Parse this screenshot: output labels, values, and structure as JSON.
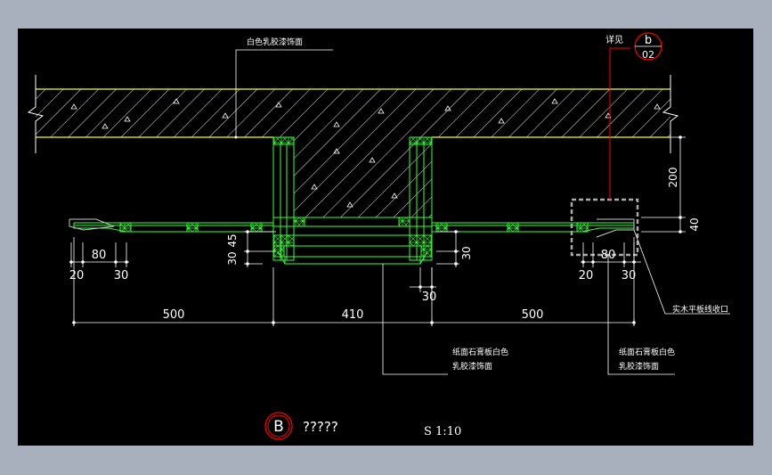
{
  "colors": {
    "background": "#000000",
    "outer": "#a9b0bd",
    "concrete_edge": "#ffff00",
    "hatch": "#ffffff",
    "frame_green": "#33ff33",
    "leader_red": "#ff0000",
    "dim": "#ffffff",
    "trim_gray": "#c8c8c8"
  },
  "labels": {
    "top_finish": "白色乳胶漆饰面",
    "detail_text": "详见",
    "detail_letter": "b",
    "detail_number": "02",
    "note1_line1": "纸面石膏板白色",
    "note1_line2": "乳胶漆饰面",
    "note2_line1": "纸面石膏板白色",
    "note2_line2": "乳胶漆饰面",
    "trim_note": "实木平板线收口",
    "section_letter": "B",
    "section_title": "?????",
    "scale": "S 1:10"
  },
  "dimensions": {
    "d500_left": "500",
    "d410": "410",
    "d500_right": "500",
    "d80_left": "80",
    "d20_left": "20",
    "d30_left": "30",
    "d30_v_left": "30",
    "d45_v_left": "45",
    "d30_v_right": "30",
    "d30_bottom_mid": "30",
    "d80_right": "80",
    "d20_right": "20",
    "d30_right": "30",
    "d200": "200",
    "d40": "40"
  }
}
